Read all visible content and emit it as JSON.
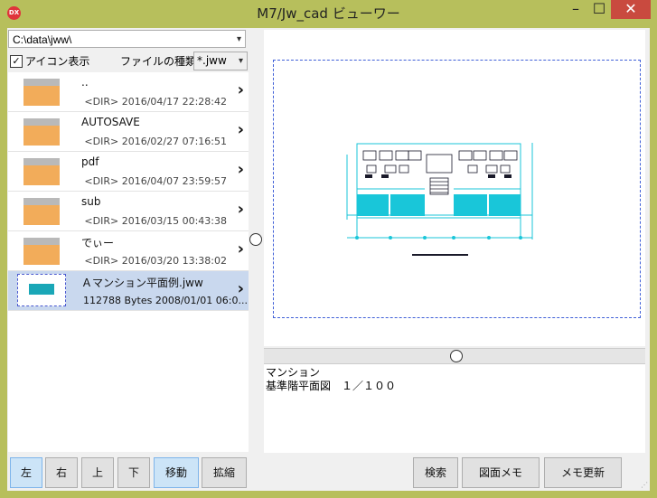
{
  "window": {
    "title": "M7/Jw_cad ビューワー",
    "app_icon_text": "DX",
    "minimize_glyph": "–",
    "maximize_glyph": "☐",
    "close_glyph": "✕"
  },
  "left": {
    "path": "C:\\data\\jww\\",
    "icon_display_label": "アイコン表示",
    "icon_display_checked": true,
    "check_glyph": "✓",
    "file_type_label": "ファイルの種類：",
    "file_type_value": "*.jww",
    "items": [
      {
        "name": "..",
        "meta": "<DIR>  2016/04/17 22:28:42",
        "kind": "folder"
      },
      {
        "name": "AUTOSAVE",
        "meta": "<DIR>  2016/02/27 07:16:51",
        "kind": "folder"
      },
      {
        "name": "pdf",
        "meta": "<DIR>  2016/04/07 23:59:57",
        "kind": "folder"
      },
      {
        "name": "sub",
        "meta": "<DIR>  2016/03/15 00:43:38",
        "kind": "folder"
      },
      {
        "name": "でぃー",
        "meta": "<DIR>  2016/03/20 13:38:02",
        "kind": "folder"
      },
      {
        "name": "Ａマンション平面例.jww",
        "meta": "112788 Bytes  2008/01/01 06:0...",
        "kind": "file",
        "selected": true
      }
    ],
    "chevron": "›"
  },
  "memo": {
    "line1": "マンション",
    "line2": "基準階平面図　１／１００"
  },
  "buttons": {
    "left": "左",
    "right": "右",
    "up": "上",
    "down": "下",
    "move": "移動",
    "zoom": "拡縮",
    "search": "検索",
    "drawing_memo": "図面メモ",
    "memo_update": "メモ更新"
  },
  "colors": {
    "title_bar": "#b7bf5c",
    "close_button": "#c94a3f",
    "selected_item": "#c9d8ee",
    "drawing_cyan": "#19c6d9",
    "paper_border": "#4060d8"
  }
}
